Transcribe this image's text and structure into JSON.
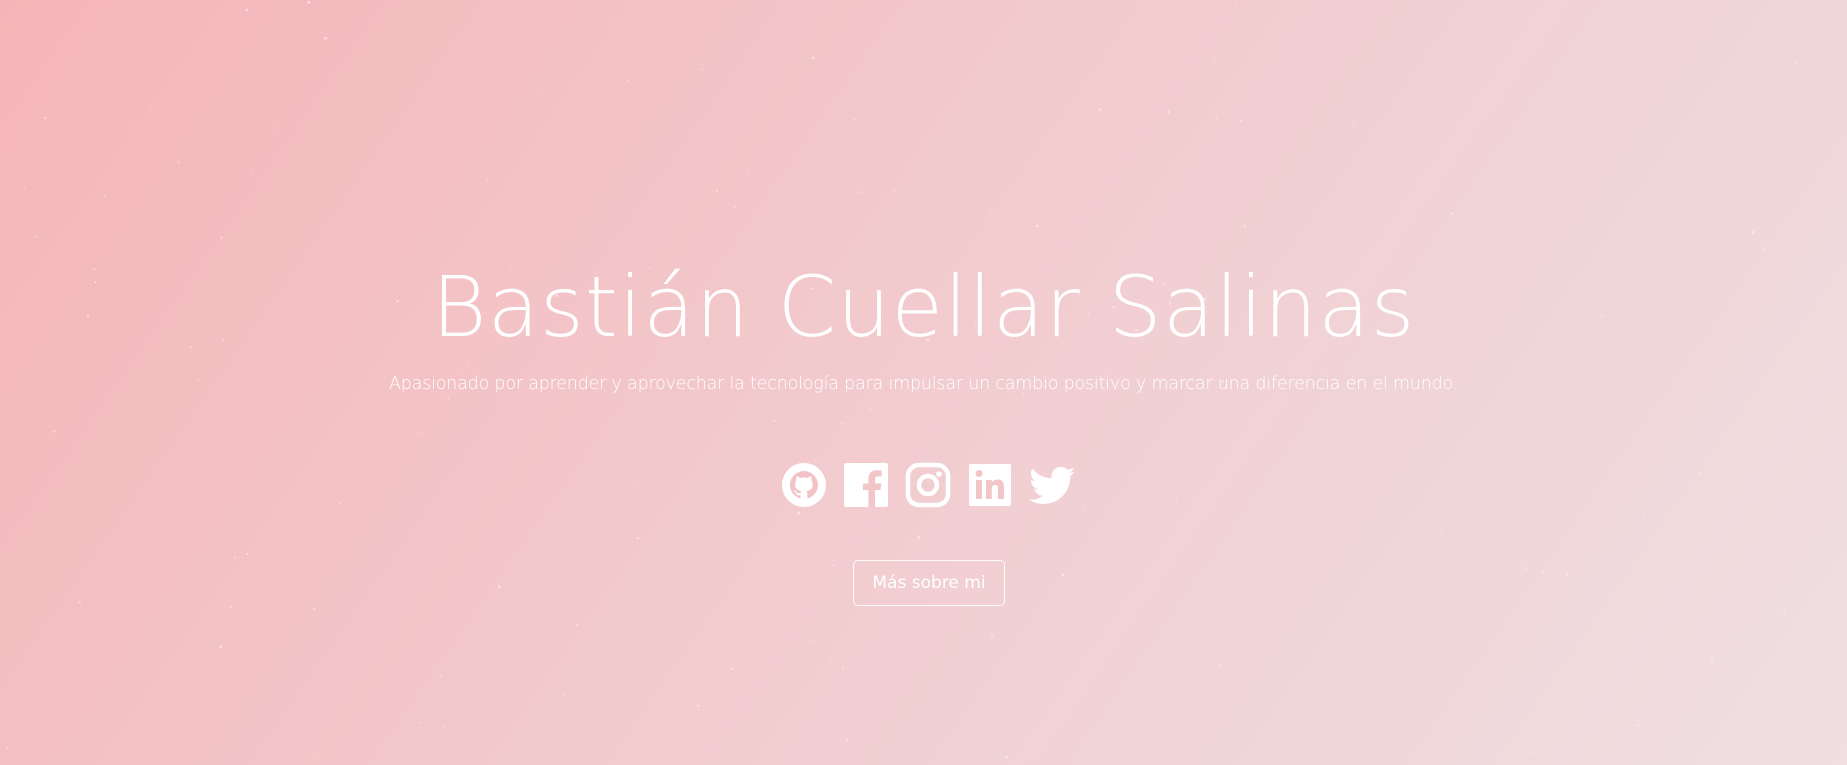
{
  "hero": {
    "title": "Bastián Cuellar Salinas",
    "subtitle": "Apasionado por aprender y aprovechar la tecnología para impulsar un cambio positivo y marcar una diferencia en el mundo.",
    "more_button_label": "Más sobre mi"
  },
  "socials": [
    {
      "icon": "github-icon"
    },
    {
      "icon": "facebook-icon"
    },
    {
      "icon": "instagram-icon"
    },
    {
      "icon": "linkedin-icon"
    },
    {
      "icon": "twitter-icon"
    }
  ],
  "colors": {
    "gradient_start": "#f5b5b8",
    "gradient_end": "#efdfe1",
    "foreground": "#ffffff"
  }
}
